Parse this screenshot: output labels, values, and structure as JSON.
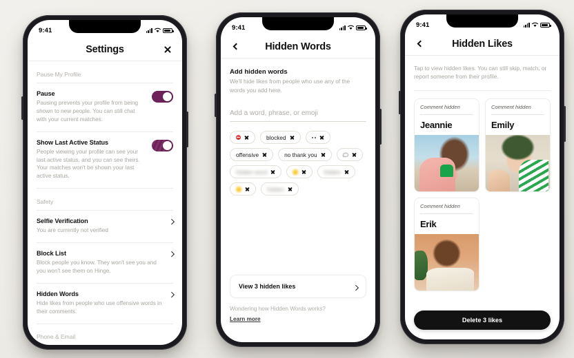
{
  "status_bar": {
    "time": "9:41",
    "signal_icon": "signal-bars-icon",
    "wifi_icon": "wifi-icon",
    "battery_icon": "battery-icon"
  },
  "colors": {
    "accent_purple": "#6E2259",
    "background": "#EFEDE9",
    "frame": "#1B1B1F",
    "button_dark": "#121212"
  },
  "phone1": {
    "nav": {
      "title": "Settings",
      "close_label": "close-icon"
    },
    "sections": [
      {
        "label": "Pause My Profile"
      },
      {
        "label": "Safety"
      }
    ],
    "rows": [
      {
        "title": "Pause",
        "sub": "Pausing prevents your profile from being shown to new people. You can still chat with your current matches.",
        "control": "toggle",
        "toggle_on": true
      },
      {
        "title": "Show Last Active Status",
        "sub": "People viewing your profile can see your last active status, and you can see theirs. Your matches won't be shown your last active status.",
        "control": "toggle",
        "toggle_on": true
      },
      {
        "title": "Selfie Verification",
        "sub": "You are currently not verified",
        "control": "chevron"
      },
      {
        "title": "Block List",
        "sub": "Block people you know. They won't see you and you won't see them on Hinge.",
        "control": "chevron"
      },
      {
        "title": "Hidden Words",
        "sub": "Hide likes from people who use offensive words in their comments.",
        "control": "chevron"
      }
    ],
    "footer_label": "Phone & Email"
  },
  "phone2": {
    "nav": {
      "title": "Hidden Words",
      "back_label": "back-icon"
    },
    "heading": "Add hidden words",
    "description": "We'll hide likes from people who use any of the words you add here.",
    "input_placeholder": "Add a word, phrase, or emoji",
    "input_value": "",
    "chips": [
      {
        "label": "",
        "emoji": "no-entry-emoji",
        "blurred": false
      },
      {
        "label": "blocked",
        "emoji": "",
        "blurred": false
      },
      {
        "label": "",
        "emoji": "dots-emoji",
        "blurred": false
      },
      {
        "label": "offensive",
        "emoji": "",
        "blurred": false
      },
      {
        "label": "no thank you",
        "emoji": "",
        "blurred": false
      },
      {
        "label": "",
        "emoji": "speech-emoji",
        "blurred": true
      },
      {
        "label": "hidden word",
        "emoji": "",
        "blurred": true
      },
      {
        "label": "",
        "emoji": "yellow-emoji",
        "blurred": true
      },
      {
        "label": "hidden",
        "emoji": "",
        "blurred": true
      },
      {
        "label": "",
        "emoji": "yellow-emoji",
        "blurred": true
      },
      {
        "label": "hidden",
        "emoji": "",
        "blurred": true
      }
    ],
    "view_card": {
      "label": "View 3 hidden likes"
    },
    "footer": {
      "question": "Wondering how Hidden Words works?",
      "link": "Learn more"
    }
  },
  "phone3": {
    "nav": {
      "title": "Hidden Likes",
      "back_label": "back-icon"
    },
    "description": "Tap to view hidden likes. You can still skip, match, or report someone from their profile.",
    "cards": [
      {
        "hidden_label": "Comment hidden",
        "name": "Jeannie",
        "photo": "ph-jeannie"
      },
      {
        "hidden_label": "Comment hidden",
        "name": "Emily",
        "photo": "ph-emily"
      },
      {
        "hidden_label": "Comment hidden",
        "name": "Erik",
        "photo": "ph-erik"
      }
    ],
    "delete_button": "Delete 3 likes"
  }
}
